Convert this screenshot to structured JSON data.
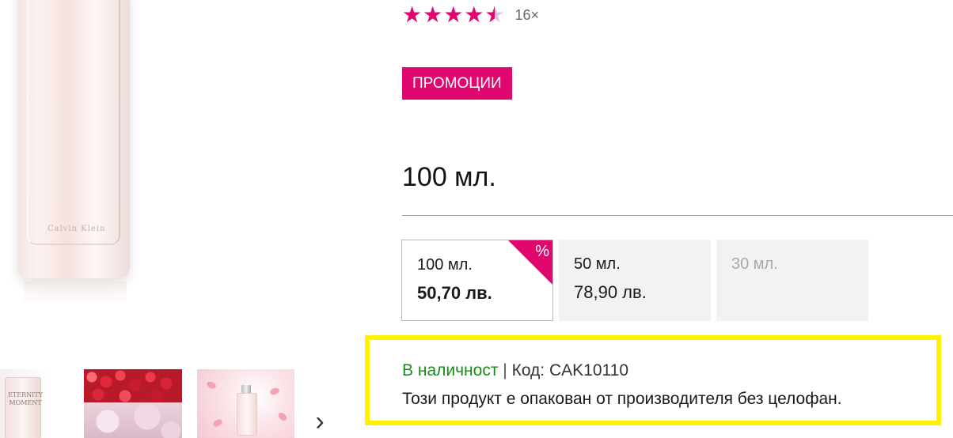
{
  "product": {
    "image_logo": "Calvin Klein",
    "rating": {
      "stars_value": 4.5,
      "max_stars": 5,
      "count_label": "16×"
    },
    "promo_badge": "ПРОМОЦИИ",
    "selected_volume": "100 мл.",
    "variants": [
      {
        "volume": "100 мл.",
        "price": "50,70 лв.",
        "discount_icon": "%"
      },
      {
        "volume": "50 мл.",
        "price": "78,90 лв."
      },
      {
        "volume": "30 мл."
      }
    ],
    "availability": {
      "status": "В наличност",
      "separator": "|",
      "code_label": "Код:",
      "code": "CAK10110",
      "note": "Този продукт е опакован от производителя без целофан."
    }
  },
  "thumbnails": {
    "items": [
      {
        "label": "ETERNITY MOMENT"
      },
      {
        "label": ""
      },
      {
        "label": ""
      }
    ],
    "next_icon": "chevron-right-icon"
  },
  "colors": {
    "accent": "#e0086f",
    "in_stock": "#1b8a1b",
    "highlight_border": "#fff200"
  }
}
